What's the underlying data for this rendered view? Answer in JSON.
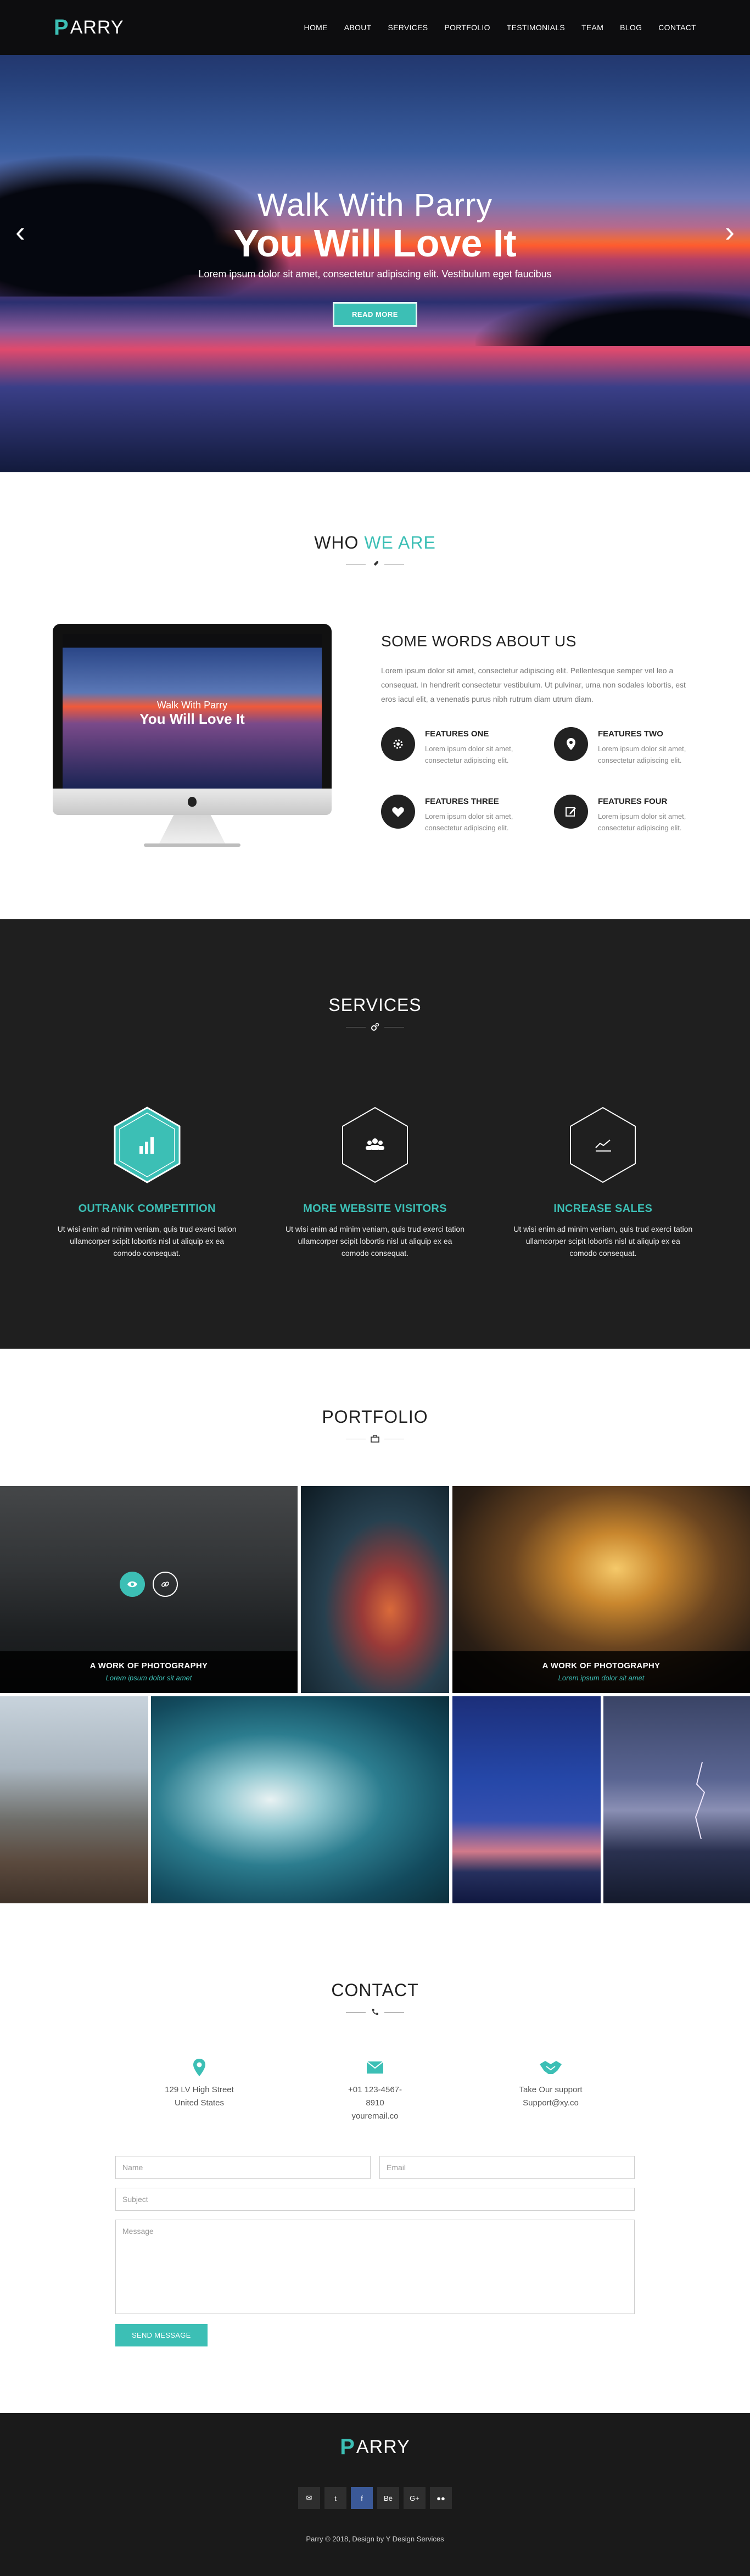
{
  "nav": {
    "logo_mark": "P",
    "logo_text": "ARRY",
    "items": [
      {
        "label": "HOME"
      },
      {
        "label": "ABOUT"
      },
      {
        "label": "SERVICES"
      },
      {
        "label": "PORTFOLIO"
      },
      {
        "label": "TESTIMONIALS"
      },
      {
        "label": "TEAM"
      },
      {
        "label": "BLOG"
      },
      {
        "label": "CONTACT"
      }
    ]
  },
  "hero": {
    "title_light": "Walk With Parry",
    "title_bold": "You Will Love It",
    "subtitle": "Lorem ipsum dolor sit amet, consectetur adipiscing elit. Vestibulum eget faucibus",
    "button": "READ MORE",
    "prev": "‹",
    "next": "›"
  },
  "who": {
    "title_a": "WHO",
    "title_b": "WE ARE",
    "heading": "SOME WORDS ABOUT US",
    "paragraph": "Lorem ipsum dolor sit amet, consectetur adipiscing elit. Pellentesque semper vel leo a consequat. In hendrerit consectetur vestibulum. Ut pulvinar, urna non sodales lobortis, est eros iacul elit, a venenatis purus nibh rutrum diam utrum diam.",
    "monitor": {
      "line1": "Walk With Parry",
      "line2": "You Will Love It"
    },
    "features": [
      {
        "title": "FEATURES ONE",
        "text": "Lorem ipsum dolor sit amet, consectetur adipiscing elit.",
        "icon": "gear-icon"
      },
      {
        "title": "FEATURES TWO",
        "text": "Lorem ipsum dolor sit amet, consectetur adipiscing elit.",
        "icon": "map-pin-icon"
      },
      {
        "title": "FEATURES THREE",
        "text": "Lorem ipsum dolor sit amet, consectetur adipiscing elit.",
        "icon": "heart-icon"
      },
      {
        "title": "FEATURES FOUR",
        "text": "Lorem ipsum dolor sit amet, consectetur adipiscing elit.",
        "icon": "edit-icon"
      }
    ]
  },
  "services": {
    "title": "SERVICES",
    "items": [
      {
        "title": "OUTRANK COMPETITION",
        "text": "Ut wisi enim ad minim veniam, quis trud exerci tation ullamcorper scipit lobortis nisl ut aliquip ex ea comodo consequat.",
        "icon": "bar-chart-icon"
      },
      {
        "title": "MORE WEBSITE VISITORS",
        "text": "Ut wisi enim ad minim veniam, quis trud exerci tation ullamcorper scipit lobortis nisl ut aliquip ex ea comodo consequat.",
        "icon": "users-icon"
      },
      {
        "title": "INCREASE SALES",
        "text": "Ut wisi enim ad minim veniam, quis trud exerci tation ullamcorper scipit lobortis nisl ut aliquip ex ea comodo consequat.",
        "icon": "trend-line-icon"
      }
    ]
  },
  "portfolio": {
    "title": "PORTFOLIO",
    "captions": [
      {
        "title": "A WORK OF PHOTOGRAPHY",
        "sub": "Lorem ipsum dolor sit amet"
      },
      {
        "title": "A WORK OF PHOTOGRAPHY",
        "sub": "Lorem ipsum dolor sit amet"
      }
    ]
  },
  "contact": {
    "title": "CONTACT",
    "info": [
      {
        "line1": "129 LV High Street",
        "line2": "United States",
        "icon": "map-pin-icon"
      },
      {
        "line1": "+01 123-4567-8910",
        "line2": "youremail.co",
        "icon": "envelope-icon"
      },
      {
        "line1": "Take Our support",
        "line2": "Support@xy.co",
        "icon": "handshake-icon"
      }
    ],
    "form": {
      "name": "Name",
      "email": "Email",
      "subject": "Subject",
      "message": "Message",
      "send": "SEND MESSAGE"
    }
  },
  "footer": {
    "logo_mark": "P",
    "logo_text": "ARRY",
    "socials": [
      {
        "label": "✉",
        "icon": "envelope-icon"
      },
      {
        "label": "t",
        "icon": "twitter-icon"
      },
      {
        "label": "f",
        "icon": "facebook-icon"
      },
      {
        "label": "Bē",
        "icon": "behance-icon"
      },
      {
        "label": "G+",
        "icon": "google-plus-icon"
      },
      {
        "label": "●●",
        "icon": "flickr-icon"
      }
    ],
    "copyright": "Parry © 2018, Design by Y Design Services"
  },
  "colors": {
    "accent": "#3cbfb5",
    "dark": "#1f1f1f",
    "nav": "#0d0d0f"
  }
}
